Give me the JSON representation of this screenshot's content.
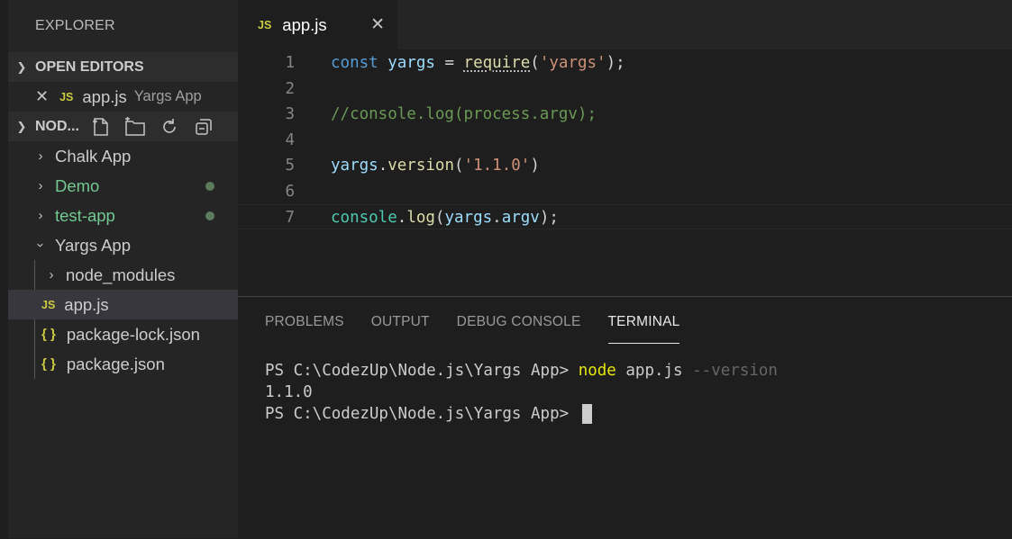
{
  "explorer": {
    "title": "EXPLORER"
  },
  "open_editors": {
    "header": "OPEN EDITORS",
    "items": [
      {
        "badge": "JS",
        "name": "app.js",
        "folder": "Yargs App"
      }
    ]
  },
  "workspace": {
    "header": "NOD...",
    "items": [
      {
        "name": "Chalk App",
        "type": "folder",
        "modified": false
      },
      {
        "name": "Demo",
        "type": "folder",
        "modified": true,
        "color": "#73c991"
      },
      {
        "name": "test-app",
        "type": "folder",
        "modified": true,
        "color": "#73c991"
      },
      {
        "name": "Yargs App",
        "type": "folder-open",
        "modified": false
      },
      {
        "name": "node_modules",
        "type": "folder",
        "modified": false
      },
      {
        "name": "app.js",
        "type": "js-file",
        "badge": "JS",
        "selected": true
      },
      {
        "name": "package-lock.json",
        "type": "json-file",
        "badge": "{ }"
      },
      {
        "name": "package.json",
        "type": "json-file",
        "badge": "{ }"
      }
    ]
  },
  "tab": {
    "badge": "JS",
    "filename": "app.js"
  },
  "code": {
    "line_numbers": [
      "1",
      "2",
      "3",
      "4",
      "5",
      "6",
      "7"
    ],
    "lines": [
      [
        {
          "t": "const",
          "c": "kw"
        },
        {
          "t": " ",
          "c": "op"
        },
        {
          "t": "yargs",
          "c": "var"
        },
        {
          "t": " = ",
          "c": "op"
        },
        {
          "t": "require",
          "c": "fn squig"
        },
        {
          "t": "(",
          "c": "op"
        },
        {
          "t": "'yargs'",
          "c": "str"
        },
        {
          "t": ");",
          "c": "op"
        }
      ],
      [],
      [
        {
          "t": "//console.log(process.argv);",
          "c": "com"
        }
      ],
      [],
      [
        {
          "t": "yargs",
          "c": "var"
        },
        {
          "t": ".",
          "c": "op"
        },
        {
          "t": "version",
          "c": "fn"
        },
        {
          "t": "(",
          "c": "op"
        },
        {
          "t": "'1.1.0'",
          "c": "str"
        },
        {
          "t": ")",
          "c": "op"
        }
      ],
      [],
      [
        {
          "t": "console",
          "c": "obj"
        },
        {
          "t": ".",
          "c": "op"
        },
        {
          "t": "log",
          "c": "fn"
        },
        {
          "t": "(",
          "c": "op"
        },
        {
          "t": "yargs",
          "c": "var"
        },
        {
          "t": ".",
          "c": "op"
        },
        {
          "t": "argv",
          "c": "var"
        },
        {
          "t": ");",
          "c": "op"
        }
      ]
    ]
  },
  "panel": {
    "tabs": [
      "PROBLEMS",
      "OUTPUT",
      "DEBUG CONSOLE",
      "TERMINAL"
    ],
    "active_tab": "TERMINAL"
  },
  "terminal": {
    "line1_prompt": "PS C:\\CodezUp\\Node.js\\Yargs App> ",
    "line1_cmd": "node",
    "line1_arg": " app.js ",
    "line1_flag": "--version",
    "line2": "1.1.0",
    "line3_prompt": "PS C:\\CodezUp\\Node.js\\Yargs App> "
  },
  "colors": {
    "js_badge": "#cbcb41",
    "modified": "#73c991",
    "accent_tab_underline": "#e7e7e7"
  }
}
